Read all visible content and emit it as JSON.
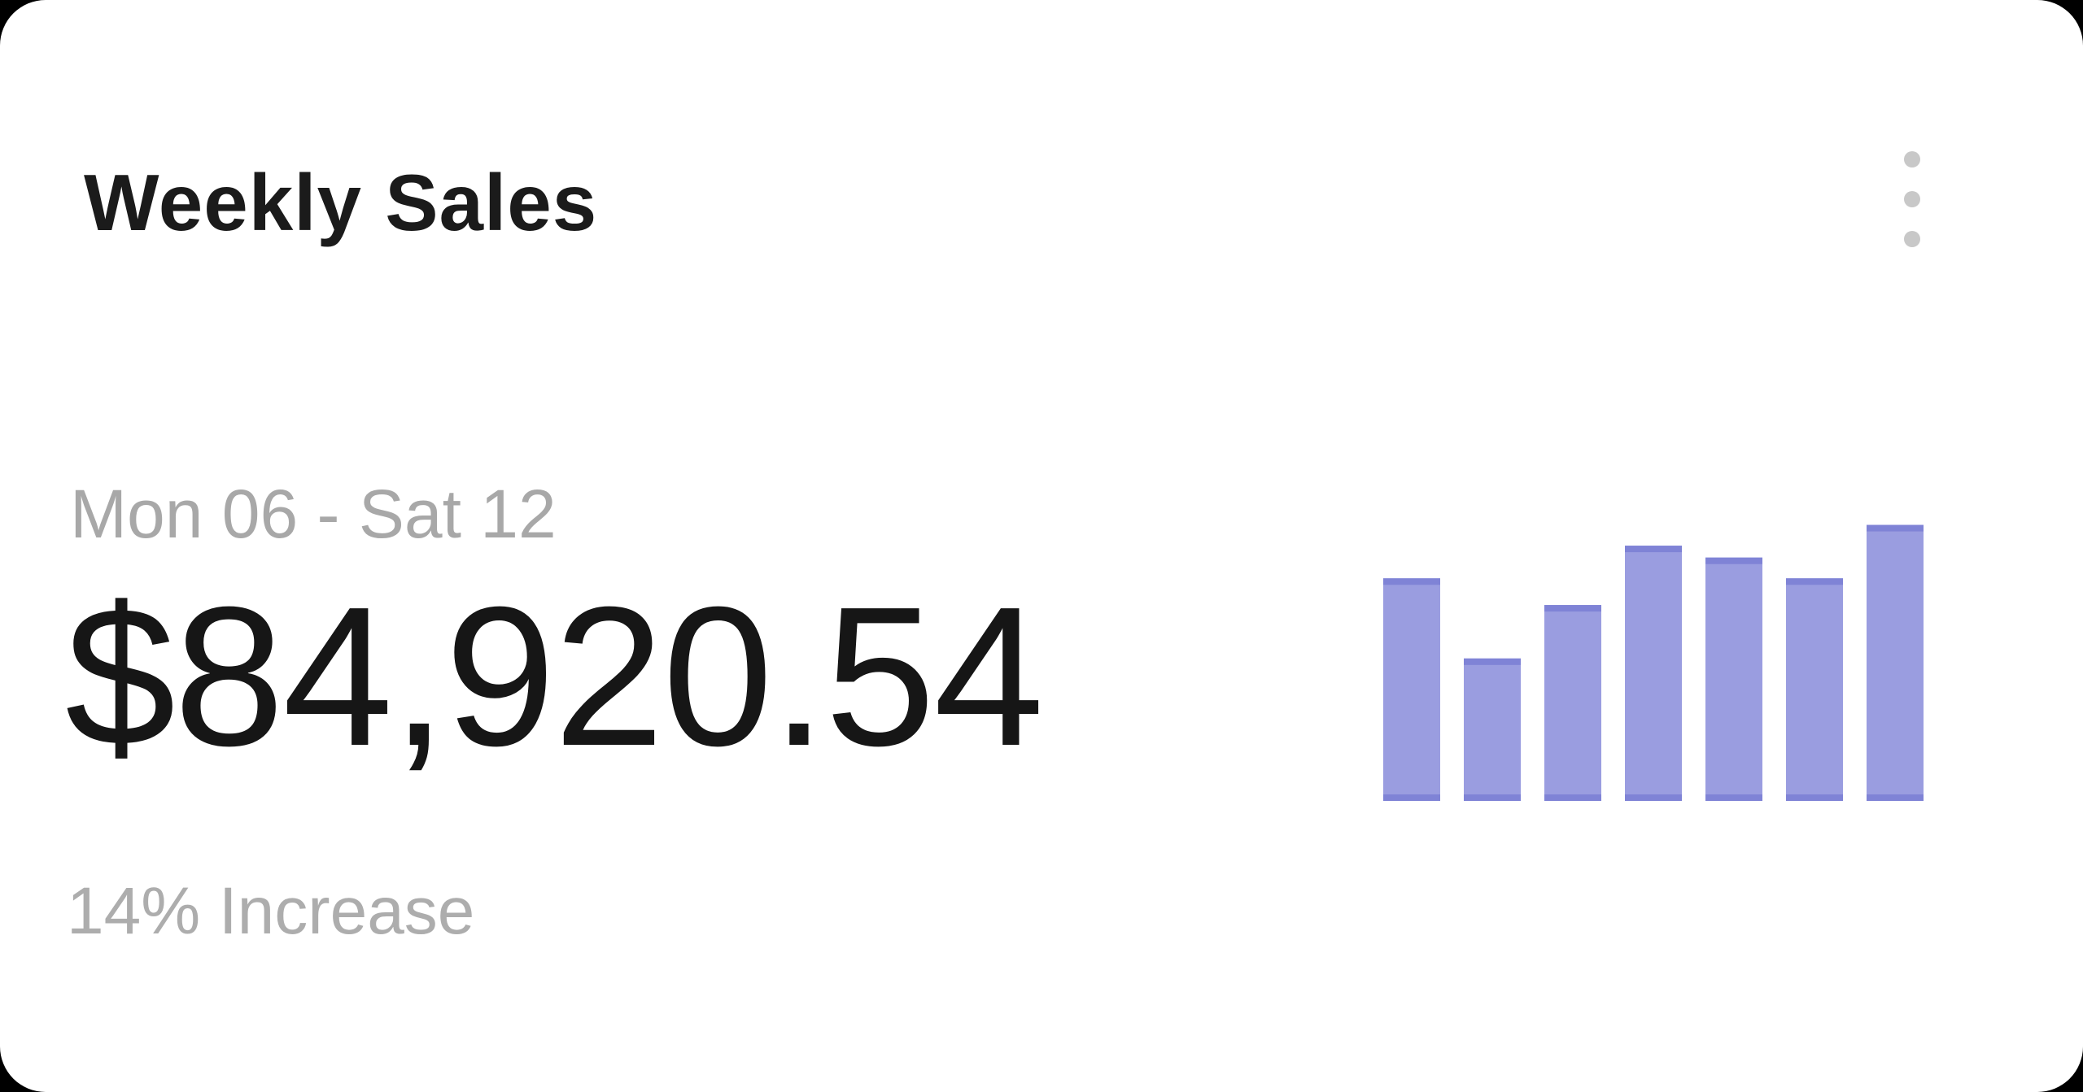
{
  "card": {
    "title": "Weekly Sales",
    "menu_icon": "more-vertical-icon",
    "date_range": "Mon 06 - Sat 12",
    "total": "$84,920.54",
    "change": "14% Increase"
  },
  "colors": {
    "bar_fill": "#9a9de0",
    "bar_edge": "#7f83d6"
  },
  "chart_data": {
    "type": "bar",
    "values": [
      0.75,
      0.48,
      0.66,
      0.86,
      0.82,
      0.75,
      0.93
    ],
    "ylim": [
      0,
      1
    ],
    "grid": false
  }
}
